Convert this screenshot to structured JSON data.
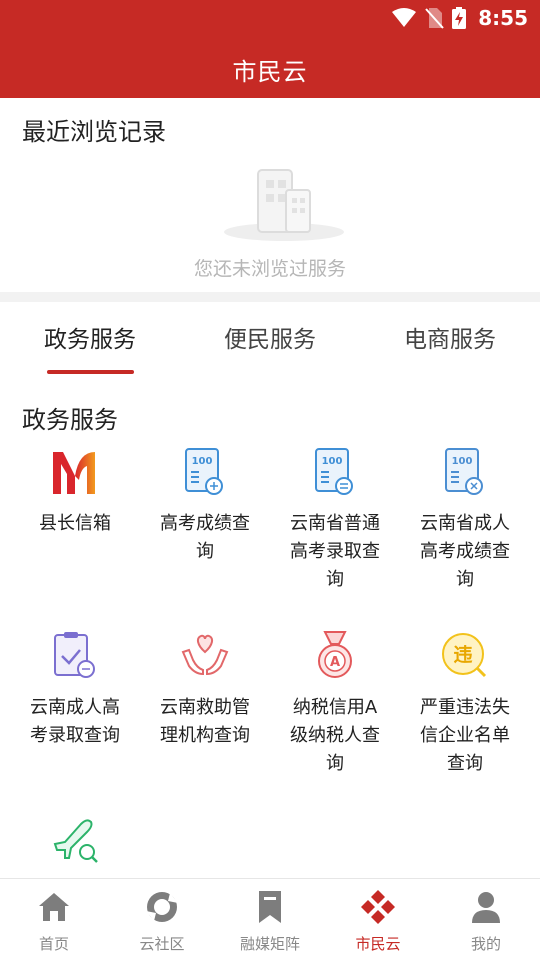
{
  "status_bar": {
    "time": "8:55"
  },
  "header": {
    "title": "市民云"
  },
  "recent": {
    "title": "最近浏览记录",
    "empty_text": "您还未浏览过服务"
  },
  "tabs": [
    {
      "label": "政务服务",
      "active": true
    },
    {
      "label": "便民服务",
      "active": false
    },
    {
      "label": "电商服务",
      "active": false
    }
  ],
  "section": {
    "title": "政务服务"
  },
  "services": [
    {
      "label": "县长信箱",
      "icon": "mailbox-logo-icon"
    },
    {
      "label": "高考成绩查询",
      "icon": "score-100-icon"
    },
    {
      "label": "云南省普通高考录取查询",
      "icon": "admission-100-icon"
    },
    {
      "label": "云南省成人高考成绩查询",
      "icon": "adult-score-100-icon"
    },
    {
      "label": "云南成人高考录取查询",
      "icon": "adult-admission-clipboard-icon"
    },
    {
      "label": "云南救助管理机构查询",
      "icon": "rescue-hands-heart-icon"
    },
    {
      "label": "纳税信用A级纳税人查询",
      "icon": "tax-medal-a-icon"
    },
    {
      "label": "严重违法失信企业名单查询",
      "icon": "violation-badge-icon"
    },
    {
      "label": "",
      "icon": "flight-search-icon"
    }
  ],
  "bottom_nav": [
    {
      "label": "首页",
      "icon": "home-icon",
      "active": false
    },
    {
      "label": "云社区",
      "icon": "community-icon",
      "active": false
    },
    {
      "label": "融媒矩阵",
      "icon": "bookmark-icon",
      "active": false
    },
    {
      "label": "市民云",
      "icon": "citizen-cloud-icon",
      "active": true
    },
    {
      "label": "我的",
      "icon": "profile-icon",
      "active": false
    }
  ],
  "colors": {
    "brand": "#c62a25",
    "muted_text": "#b6b6b6",
    "nav_inactive": "#888888"
  }
}
